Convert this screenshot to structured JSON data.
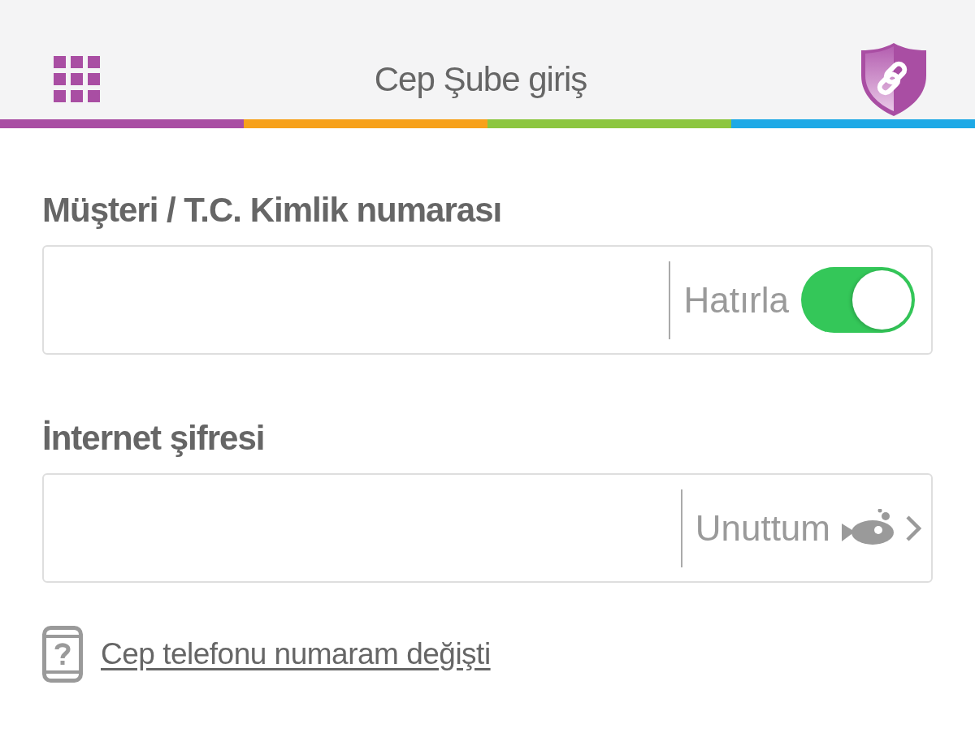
{
  "header": {
    "title": "Cep Şube giriş"
  },
  "fields": [
    {
      "kind": "toggle",
      "label": "Müşteri / T.C. Kimlik numarası",
      "action": {
        "label": "Hatırla",
        "on": true
      }
    },
    {
      "kind": "link",
      "label": "İnternet şifresi",
      "action": {
        "label": "Unuttum"
      }
    }
  ],
  "footer_link": {
    "label": "Cep telefonu numaram değişti"
  }
}
